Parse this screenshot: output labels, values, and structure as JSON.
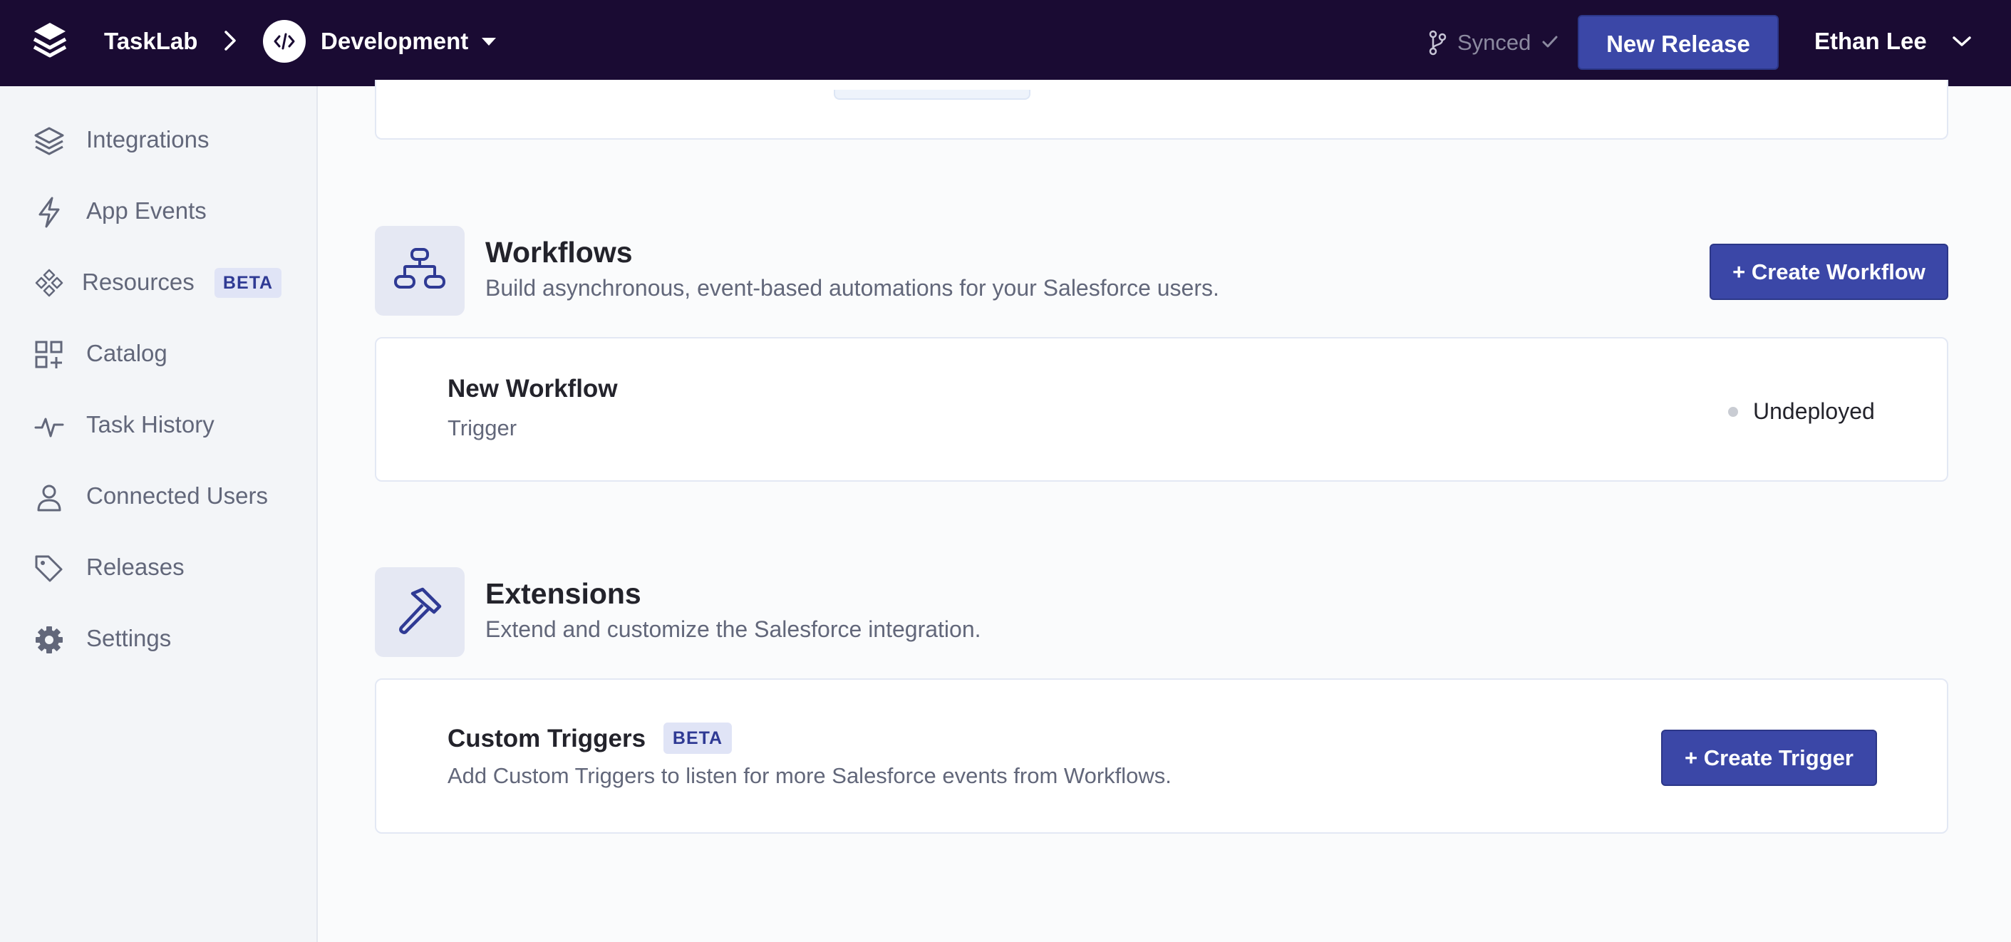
{
  "header": {
    "brand": "TaskLab",
    "environment": "Development",
    "sync_status": "Synced",
    "new_release_label": "New Release",
    "user_name": "Ethan Lee"
  },
  "sidebar": {
    "items": [
      {
        "label": "Integrations",
        "icon": "layers-icon"
      },
      {
        "label": "App Events",
        "icon": "lightning-icon"
      },
      {
        "label": "Resources",
        "icon": "diamond-grid-icon",
        "badge": "BETA"
      },
      {
        "label": "Catalog",
        "icon": "grid-plus-icon"
      },
      {
        "label": "Task History",
        "icon": "activity-icon"
      },
      {
        "label": "Connected Users",
        "icon": "user-icon"
      },
      {
        "label": "Releases",
        "icon": "tag-icon"
      },
      {
        "label": "Settings",
        "icon": "gear-icon"
      }
    ]
  },
  "workflows": {
    "title": "Workflows",
    "subtitle": "Build asynchronous, event-based automations for your Salesforce users.",
    "create_label": "+ Create Workflow",
    "items": [
      {
        "name": "New Workflow",
        "type": "Trigger",
        "status": "Undeployed"
      }
    ]
  },
  "extensions": {
    "title": "Extensions",
    "subtitle": "Extend and customize the Salesforce integration.",
    "custom_triggers": {
      "title": "Custom Triggers",
      "badge": "BETA",
      "description": "Add Custom Triggers to listen for more Salesforce events from Workflows.",
      "create_label": "+ Create Trigger"
    }
  },
  "colors": {
    "topbar": "#1a0b33",
    "primary": "#3b47a7",
    "badge_bg": "#e0e4f6",
    "badge_text": "#2f3a94"
  }
}
